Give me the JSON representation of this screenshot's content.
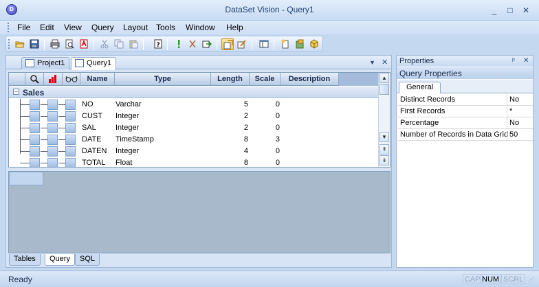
{
  "window": {
    "title": "DataSet Vision - Query1",
    "minimize": "_",
    "maximize": "□",
    "close": "✕"
  },
  "menu": [
    "File",
    "Edit",
    "View",
    "Query",
    "Layout",
    "Tools",
    "Window",
    "Help"
  ],
  "toolbar": {
    "icons": [
      "open-folder-icon",
      "save-icon",
      "print-icon",
      "print-preview-icon",
      "pdf-export-icon",
      "cut-icon",
      "copy-icon",
      "paste-icon",
      "help-icon",
      "execute-icon",
      "stop-icon",
      "export-icon",
      "query-design-icon",
      "query-edit-icon",
      "layout-icon",
      "new-report-icon",
      "add-table-icon",
      "cube-icon"
    ]
  },
  "doc_tabs": [
    {
      "label": "Project1",
      "active": false
    },
    {
      "label": "Query1",
      "active": true
    }
  ],
  "doc_controls": {
    "dropdown": "▼",
    "close": "✕"
  },
  "grid": {
    "columns": [
      "Name",
      "Type",
      "Length",
      "Scale",
      "Description"
    ],
    "group": {
      "expander": "−",
      "label": "Sales"
    },
    "rows": [
      {
        "name": "NO",
        "type": "Varchar",
        "length": "5",
        "scale": "0"
      },
      {
        "name": "CUST",
        "type": "Integer",
        "length": "2",
        "scale": "0"
      },
      {
        "name": "SAL",
        "type": "Integer",
        "length": "2",
        "scale": "0"
      },
      {
        "name": "DATE",
        "type": "TimeStamp",
        "length": "8",
        "scale": "3"
      },
      {
        "name": "DATEN",
        "type": "Integer",
        "length": "4",
        "scale": "0"
      },
      {
        "name": "TOTAL",
        "type": "Float",
        "length": "8",
        "scale": "0"
      }
    ]
  },
  "bottom_tabs": [
    {
      "label": "Tables",
      "active": false
    },
    {
      "label": "Query",
      "active": true
    },
    {
      "label": "SQL",
      "active": false
    }
  ],
  "properties": {
    "title": "Properties",
    "pin": "ᵖ",
    "close": "✕",
    "subtitle": "Query Properties",
    "tab": "General",
    "rows": [
      {
        "key": "Distinct Records",
        "value": "No"
      },
      {
        "key": "First Records",
        "value": "*"
      },
      {
        "key": "Percentage",
        "value": "No"
      },
      {
        "key": "Number of Records in Data Grid",
        "value": "50"
      }
    ]
  },
  "status": {
    "text": "Ready",
    "indicators": [
      "CAP",
      "NUM",
      "SCRL"
    ]
  }
}
